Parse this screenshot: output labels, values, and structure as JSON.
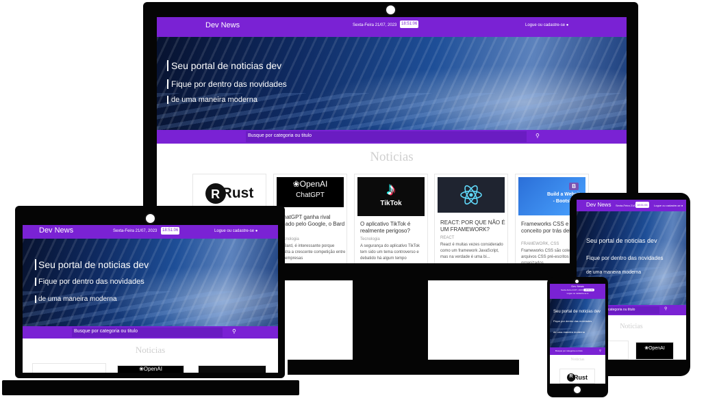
{
  "site": {
    "brand": "Dev News",
    "date": "Sexta-Feira 21/07, 2023",
    "time": "18:51:06",
    "login": "Logue ou cadastre-se",
    "user_icon": "user-icon",
    "hero_title": "Seu portal de noticias dev",
    "hero_line1": "Fique por dentro das novidades",
    "hero_line2": "de uma maneira moderna",
    "search_placeholder": "Busque por categoria ou titulo",
    "search_icon": "search-icon",
    "section_title": "Noticias"
  },
  "colors": {
    "primary": "#7a22d4",
    "frame": "#050505"
  },
  "cards": [
    {
      "thumb": "Rust"
    },
    {
      "thumb_brand": "OpenAI",
      "thumb_sub": "ChatGPT",
      "title": "ChatGPT ganha rival criado pelo Google, o Bard",
      "category": "Tecnologia",
      "text": "O Bard, é interessante porque ilustra a crescente competição entre as empresas"
    },
    {
      "thumb": "TikTok",
      "title": "O aplicativo TikTok é realmente perigoso?",
      "category": "Tecnologia",
      "text": "A segurança do aplicativo TikTok tem sido um tema controverso e debatido há algum tempo"
    },
    {
      "title": "REACT: POR QUE NÃO É UM FRAMEWORK?",
      "category": "REACT",
      "text": "React é muitas vezes considerado como um framework JavaScript, mas na verdade é uma bi..."
    },
    {
      "thumb_badge": "B",
      "thumb_title": "Build a Website",
      "thumb_sub": "- Bootstrap",
      "title": "Frameworks CSS e o pré-conceito por trás deles",
      "category": "FRAMEWORK, CSS",
      "text": "Frameworks CSS são coleções de arquivos CSS pré-escritos e organizados"
    }
  ],
  "tablet": {
    "date": "Sexta-Feira 21/07, 2023"
  },
  "phone": {
    "date": "Sexta-Feira 21/07, 2023",
    "time": "18:51:06"
  }
}
